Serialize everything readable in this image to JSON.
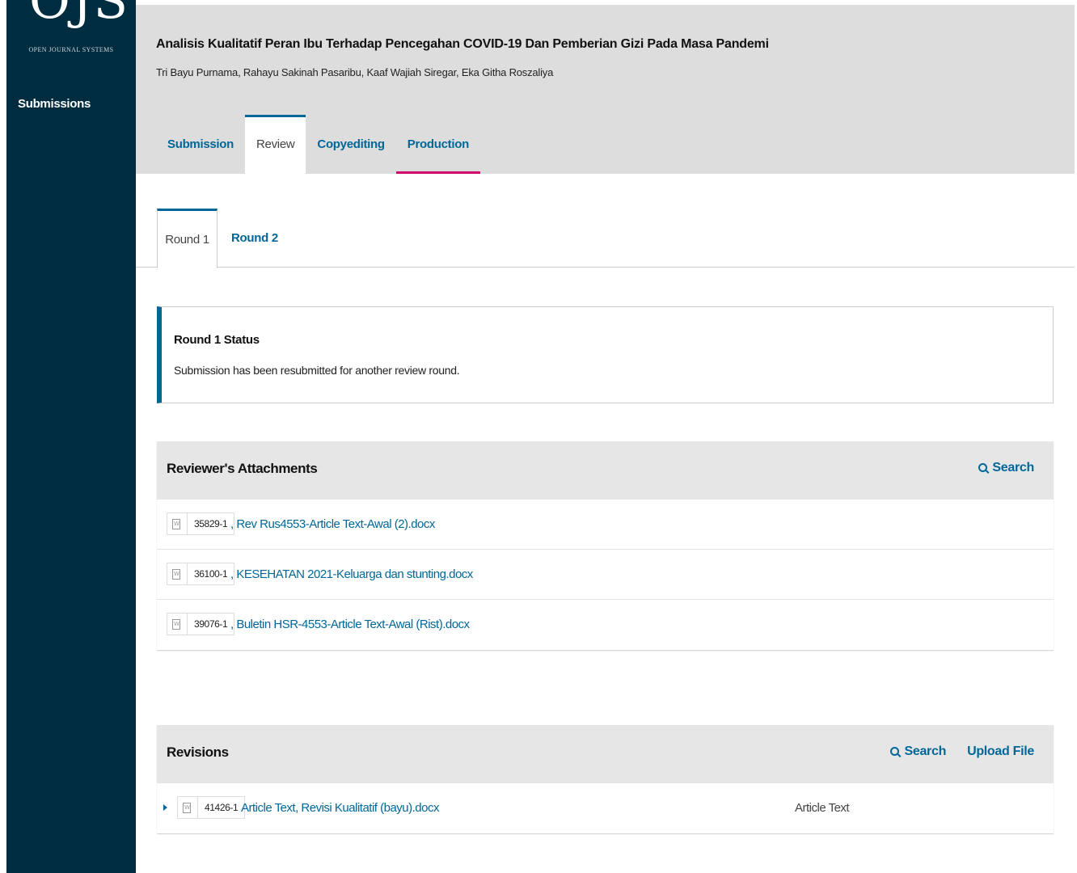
{
  "app": {
    "logo_mark": "OJS",
    "logo_subtitle": "OPEN JOURNAL SYSTEMS"
  },
  "sidebar": {
    "items": [
      {
        "label": "Submissions"
      }
    ]
  },
  "header": {
    "title": "Analisis Kualitatif Peran Ibu Terhadap Pencegahan COVID-19 Dan Pemberian Gizi Pada Masa Pandemi",
    "authors": "Tri Bayu Purnama, Rahayu Sakinah Pasaribu, Kaaf Wajiah Siregar, Eka Githa Roszaliya"
  },
  "main_tabs": [
    {
      "label": "Submission"
    },
    {
      "label": "Review"
    },
    {
      "label": "Copyediting"
    },
    {
      "label": "Production"
    }
  ],
  "round_tabs": [
    {
      "label": "Round 1"
    },
    {
      "label": "Round 2"
    }
  ],
  "status": {
    "title": "Round 1 Status",
    "text": "Submission has been resubmitted for another review round."
  },
  "reviewer_attachments": {
    "title": "Reviewer's Attachments",
    "search_label": "Search",
    "files": [
      {
        "id": "35829-1",
        "name": ", Rev Rus4553-Article Text-Awal (2).docx"
      },
      {
        "id": "36100-1",
        "name": ", KESEHATAN 2021-Keluarga dan stunting.docx"
      },
      {
        "id": "39076-1",
        "name": ", Buletin HSR-4553-Article Text-Awal (Rist).docx"
      }
    ]
  },
  "revisions": {
    "title": "Revisions",
    "search_label": "Search",
    "upload_label": "Upload File",
    "files": [
      {
        "id": "41426-1",
        "name": "Article Text, Revisi Kualitatif (bayu).docx",
        "type": "Article Text"
      }
    ]
  },
  "colors": {
    "sidebar_bg": "#002c40",
    "link": "#006798",
    "production_accent": "#d00a6c",
    "header_bg": "#dddddd"
  }
}
